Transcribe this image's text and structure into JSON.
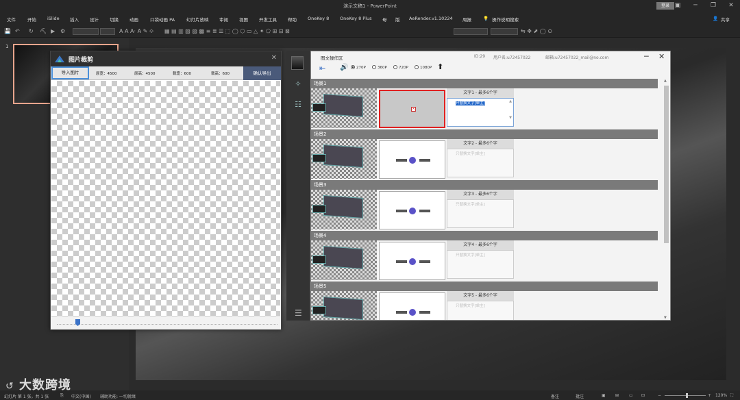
{
  "app": {
    "title": "演示文稿1 - PowerPoint",
    "login": "登录",
    "share": "共享"
  },
  "menu": [
    "文件",
    "开始",
    "iSlide",
    "插入",
    "设计",
    "切换",
    "动画",
    "口袋动画 PA",
    "幻灯片放映",
    "审阅",
    "视图",
    "开发工具",
    "帮助",
    "OneKey 8",
    "OneKey 8 Plus",
    "母",
    "版",
    "AeRender.v1.10224",
    "周报",
    "操作说明搜索"
  ],
  "thumbnails": {
    "slide_number": "1"
  },
  "crop_dialog": {
    "title": "图片裁剪",
    "import_label": "导入图片",
    "orig_width": "原宽：4500",
    "orig_height": "原高：4500",
    "crop_width": "裁宽：600",
    "crop_height": "裁高：600",
    "export_label": "确认导出",
    "slider_value": 0.08
  },
  "ops_panel": {
    "title": "图文操作区",
    "id": "ID:29",
    "user": "用户名:u72457022",
    "email": "邮箱:u72457022_mail@no.com",
    "resolutions": [
      "270P",
      "360P",
      "720P",
      "1080P"
    ],
    "selected_resolution": "270P",
    "scenes": [
      {
        "name": "场景1",
        "text_header": "文字1 - 最多6个字",
        "placeholder": "只替换文字[单主]",
        "selected": true
      },
      {
        "name": "场景2",
        "text_header": "文字2 - 最多6个字",
        "placeholder": "只替换文字[单主]",
        "selected": false
      },
      {
        "name": "场景3",
        "text_header": "文字3 - 最多6个字",
        "placeholder": "只替换文字[单主]",
        "selected": false
      },
      {
        "name": "场景4",
        "text_header": "文字4 - 最多6个字",
        "placeholder": "只替换文字[单主]",
        "selected": false
      },
      {
        "name": "场景5",
        "text_header": "文字5 - 最多6个字",
        "placeholder": "只替换文字[单主]",
        "selected": false
      }
    ]
  },
  "status": {
    "slide_info": "幻灯片 第 1 张，共 1 张",
    "language": "中文(中国)",
    "accessibility": "辅助功能: 一切就绪",
    "notes": "备注",
    "comments": "批注",
    "zoom": "120%"
  },
  "watermark": "大数跨境"
}
